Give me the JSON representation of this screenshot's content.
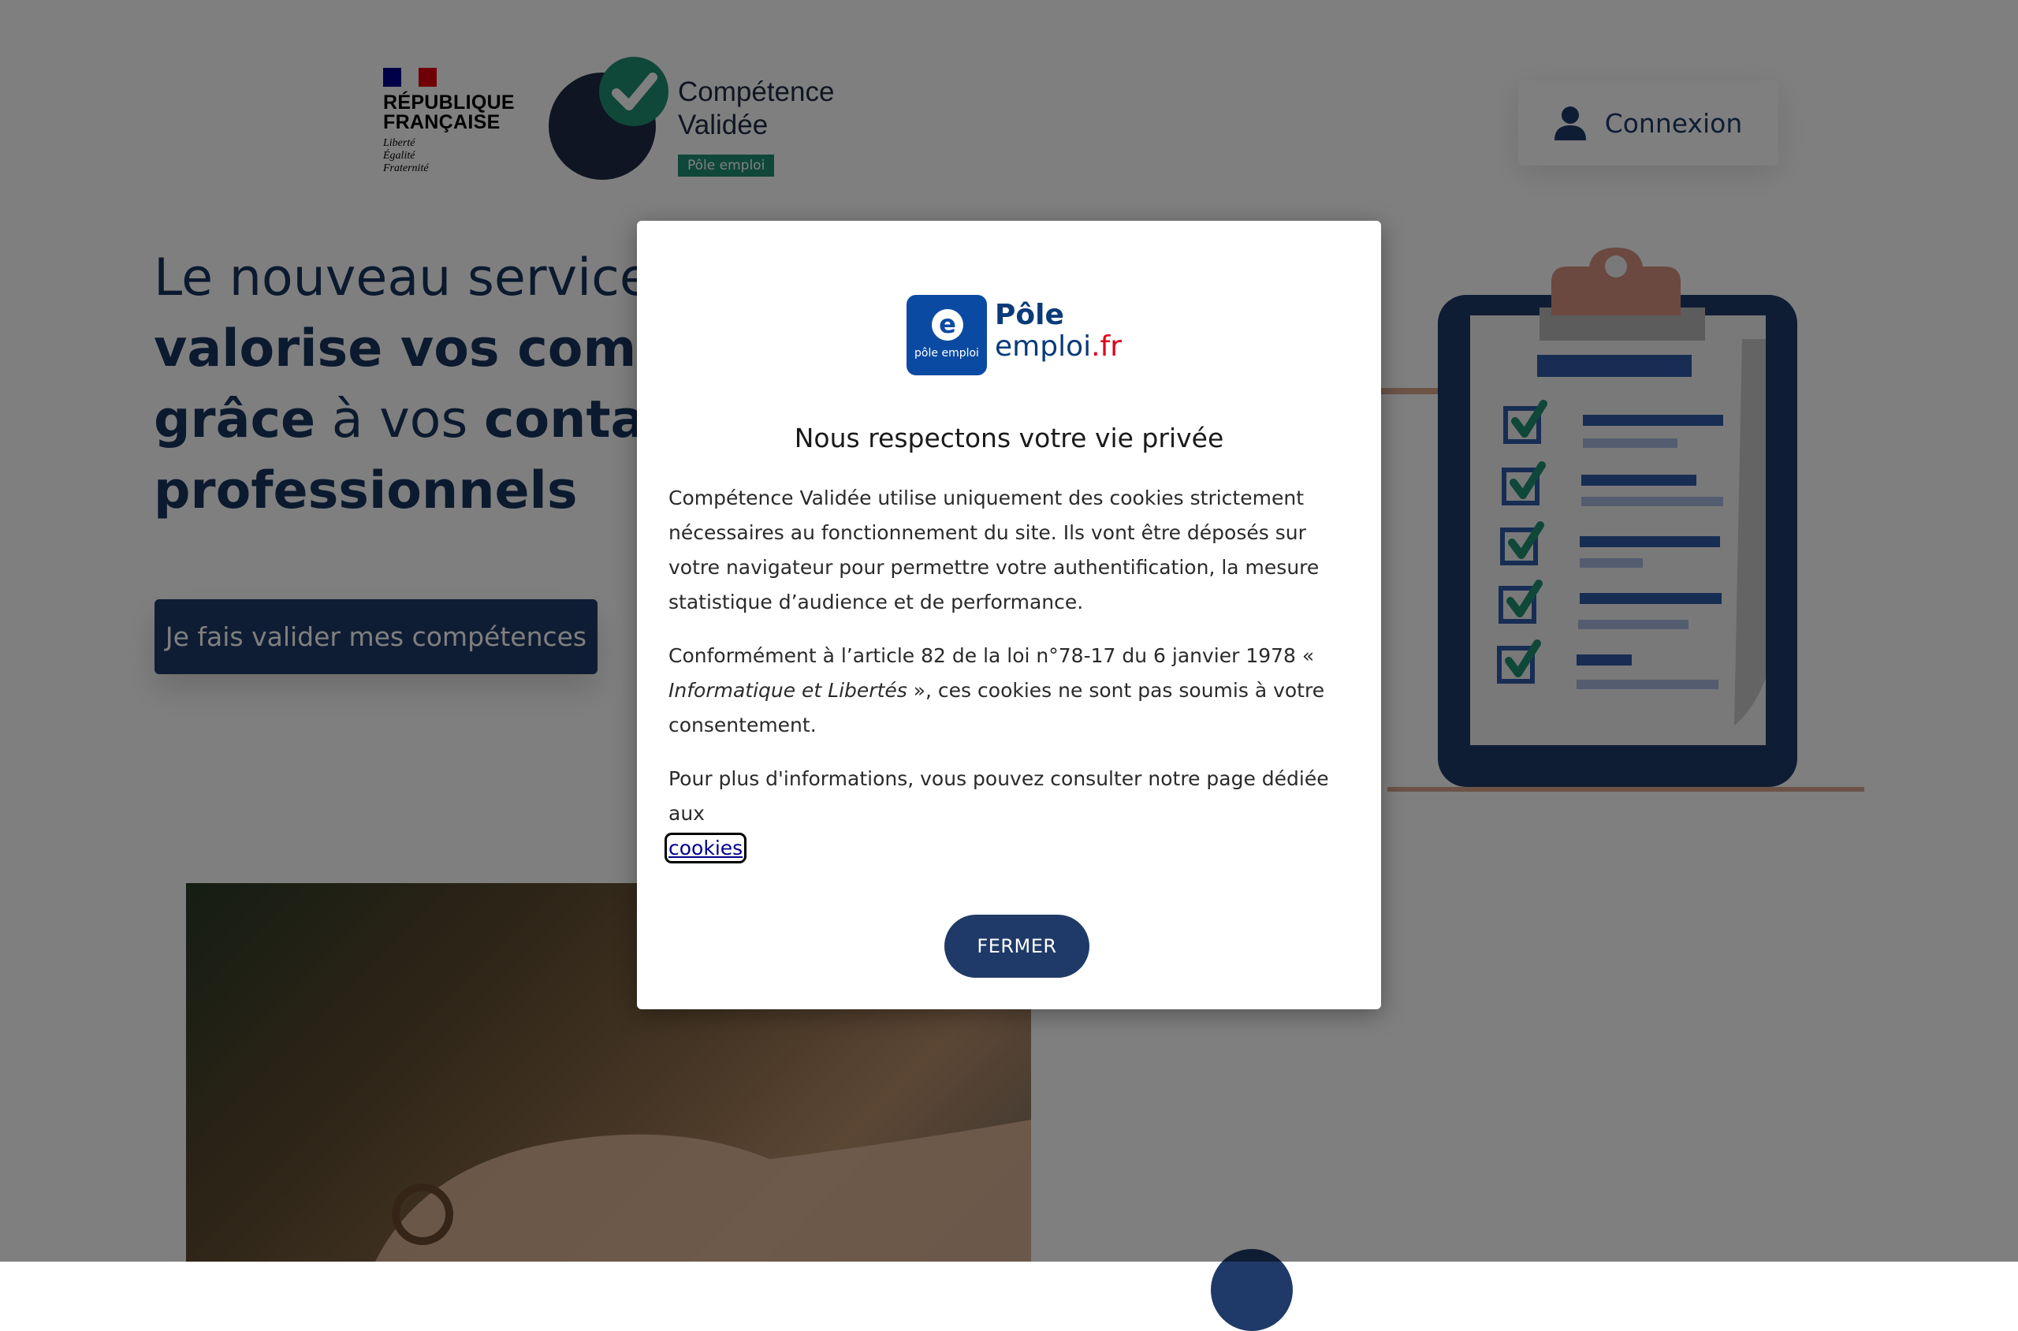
{
  "header": {
    "marianne": {
      "line1": "RÉPUBLIQUE",
      "line2": "FRANÇAISE",
      "motto1": "Liberté",
      "motto2": "Égalité",
      "motto3": "Fraternité"
    },
    "brand": {
      "name_line1": "Compétence",
      "name_line2": "Validée",
      "tag": "Pôle emploi"
    },
    "connexion_label": "Connexion"
  },
  "hero": {
    "title_part1": "Le nouveau service qui",
    "title_part2": "valorise vos compétences",
    "title_part3": "grâce",
    "title_part4": " à vos ",
    "title_part5": "contacts",
    "title_part6": "professionnels",
    "cta_label": "Je fais valider mes compétences"
  },
  "modal": {
    "logo": {
      "badge_letter": "e",
      "badge_text": "pôle emploi",
      "word1": "Pôle",
      "word2": "emploi",
      "word2_suffix": ".fr"
    },
    "title": "Nous respectons votre vie privée",
    "paragraph1": "Compétence Validée utilise uniquement des cookies strictement nécessaires au fonctionnement du site. Ils vont être déposés sur votre navigateur pour permettre votre authentification, la mesure statistique d’audience et de performance.",
    "paragraph2_before": "Conformément à l’article 82 de la loi n°78-17 du 6 janvier 1978 « ",
    "paragraph2_italic": "Informatique et Libertés",
    "paragraph2_after": " », ces cookies ne sont pas soumis à votre consentement.",
    "paragraph3_before": "Pour plus d'informations, vous pouvez consulter notre page dédiée aux ",
    "cookies_link": "cookies",
    "close_label": "FERMER"
  },
  "colors": {
    "primary": "#1f3a68",
    "accent_green": "#1f8f73",
    "pole_emploi_blue": "#0b4aa2",
    "pole_emploi_red": "#e2001a"
  }
}
